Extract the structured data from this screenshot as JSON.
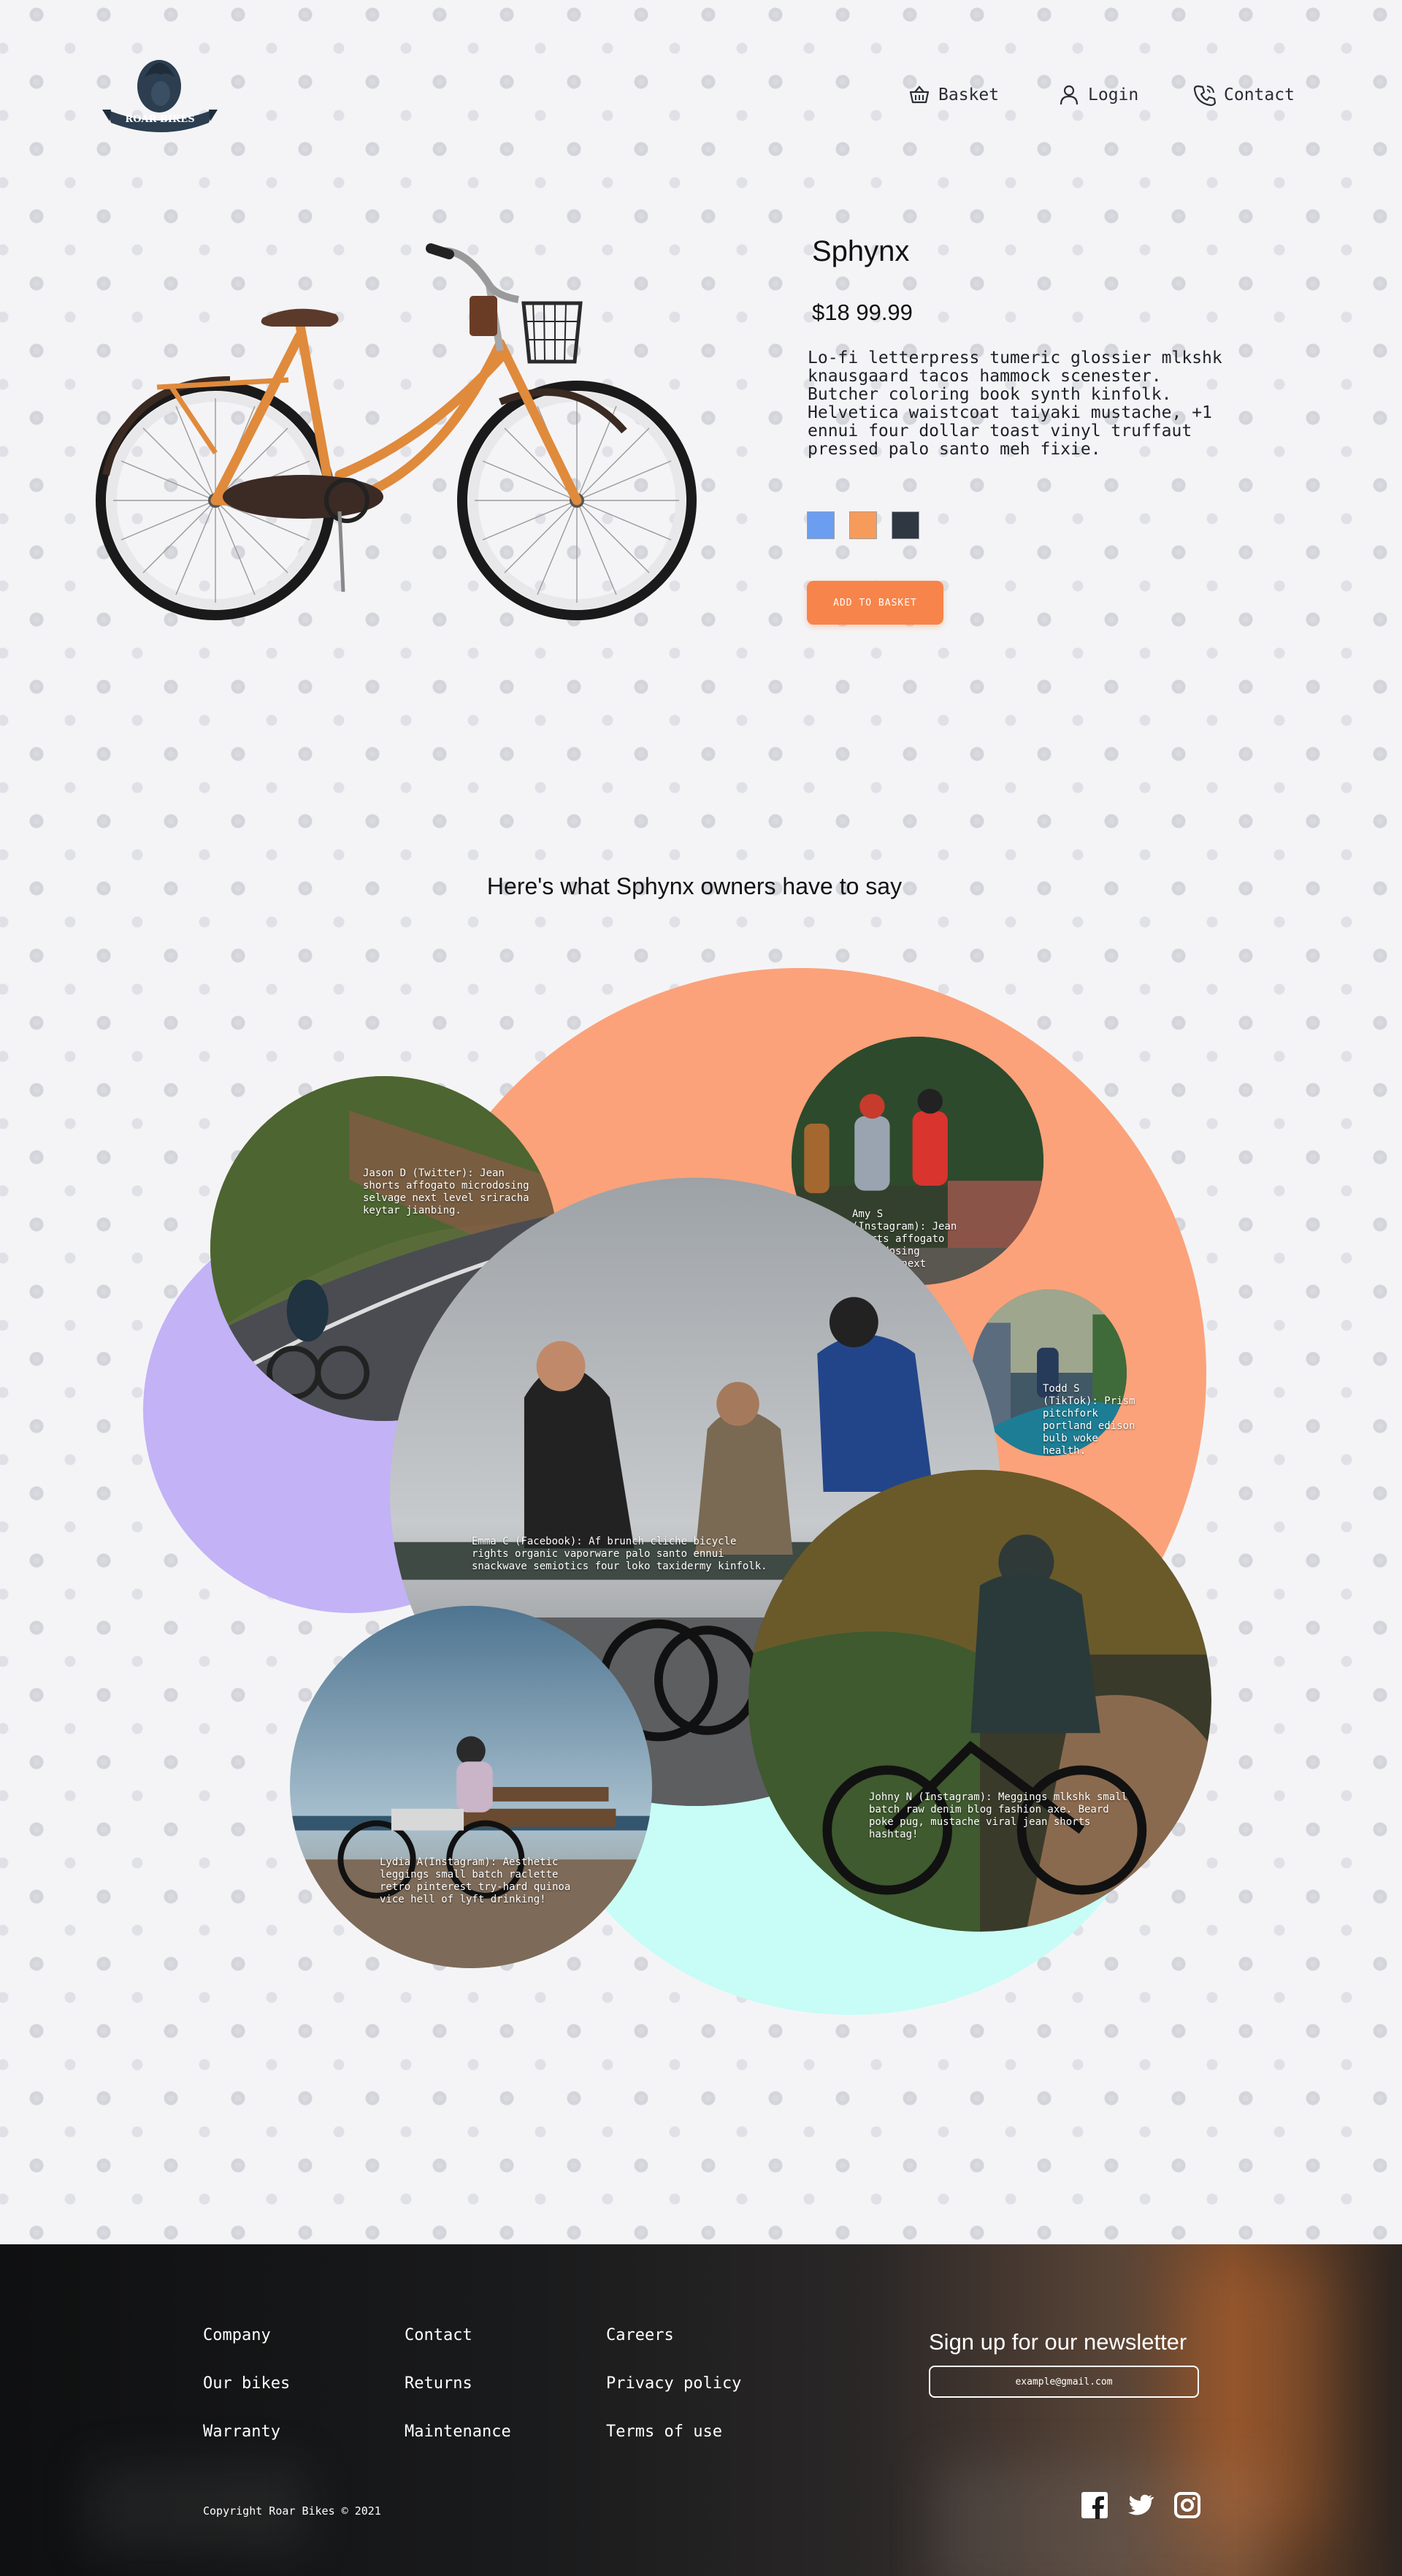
{
  "brand": {
    "name": "ROAR BIKES"
  },
  "nav": {
    "basket": "Basket",
    "login": "Login",
    "contact": "Contact"
  },
  "product": {
    "title": "Sphynx",
    "price": "$18 99.99",
    "description": "Lo-fi letterpress tumeric glossier mlkshk knausgaard tacos hammock scenester. Butcher coloring book synth kinfolk. Helvetica waistcoat taiyaki mustache, +1 ennui four dollar toast vinyl truffaut pressed palo santo meh fixie.",
    "colors": [
      "#6b9ef0",
      "#f79b5a",
      "#2f3743"
    ],
    "add_to_basket": "ADD TO BASKET"
  },
  "testimonials": {
    "heading": "Here's what Sphynx owners have to say",
    "items": [
      {
        "text": "Jason D (Twitter): Jean shorts affogato microdosing selvage next level sriracha keytar jianbing."
      },
      {
        "text": "Amy S (Instagram): Jean shorts affogato microdosing selvage next level."
      },
      {
        "text": "Todd S (TikTok): Prism pitchfork portland edison bulb woke health."
      },
      {
        "text": "Emma C (Facebook): Af brunch cliche bicycle rights organic vaporware palo santo ennui snackwave semiotics four loko taxidermy kinfolk."
      },
      {
        "text": "Lydia A(Instagram): Aesthetic leggings small batch raclette retro pinterest try-hard quinoa vice hell of lyft drinking!"
      },
      {
        "text": "Johny N (Instagram): Meggings mlkshk small batch raw denim blog fashion axe. Beard poke pug, mustache viral jean shorts hashtag!"
      }
    ]
  },
  "footer": {
    "col1": [
      "Company",
      "Our bikes",
      "Warranty"
    ],
    "col2": [
      "Contact",
      "Returns",
      "Maintenance"
    ],
    "col3": [
      "Careers",
      "Privacy policy",
      "Terms of use"
    ],
    "newsletter_title": "Sign up for our newsletter",
    "newsletter_placeholder": "example@gmail.com",
    "copyright": "Copyright Roar Bikes © 2021",
    "social": [
      "facebook-icon",
      "twitter-icon",
      "instagram-icon"
    ]
  }
}
